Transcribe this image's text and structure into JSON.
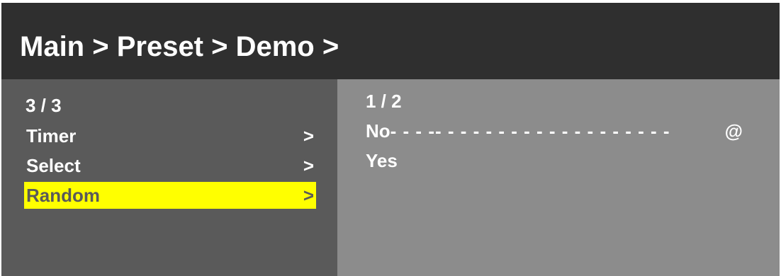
{
  "header": {
    "breadcrumb": "Main > Preset > Demo >"
  },
  "left_panel": {
    "page": "3 / 3",
    "items": [
      {
        "label": "Timer",
        "chevron": ">",
        "selected": false
      },
      {
        "label": "Select",
        "chevron": ">",
        "selected": false
      },
      {
        "label": "Random",
        "chevron": ">",
        "selected": true
      }
    ]
  },
  "right_panel": {
    "page": "1 / 2",
    "options": [
      {
        "label": "No",
        "leader": "- - - -- - - - - - - - - - - - - - - - - - -",
        "marker": "@",
        "current": true
      },
      {
        "label": "Yes",
        "leader": "",
        "marker": "",
        "current": false
      }
    ]
  },
  "colors": {
    "header_bg": "#2f2f2f",
    "left_panel_bg": "#5a5a5a",
    "right_panel_bg": "#8c8c8c",
    "highlight": "#ffff00",
    "text": "#ffffff"
  }
}
